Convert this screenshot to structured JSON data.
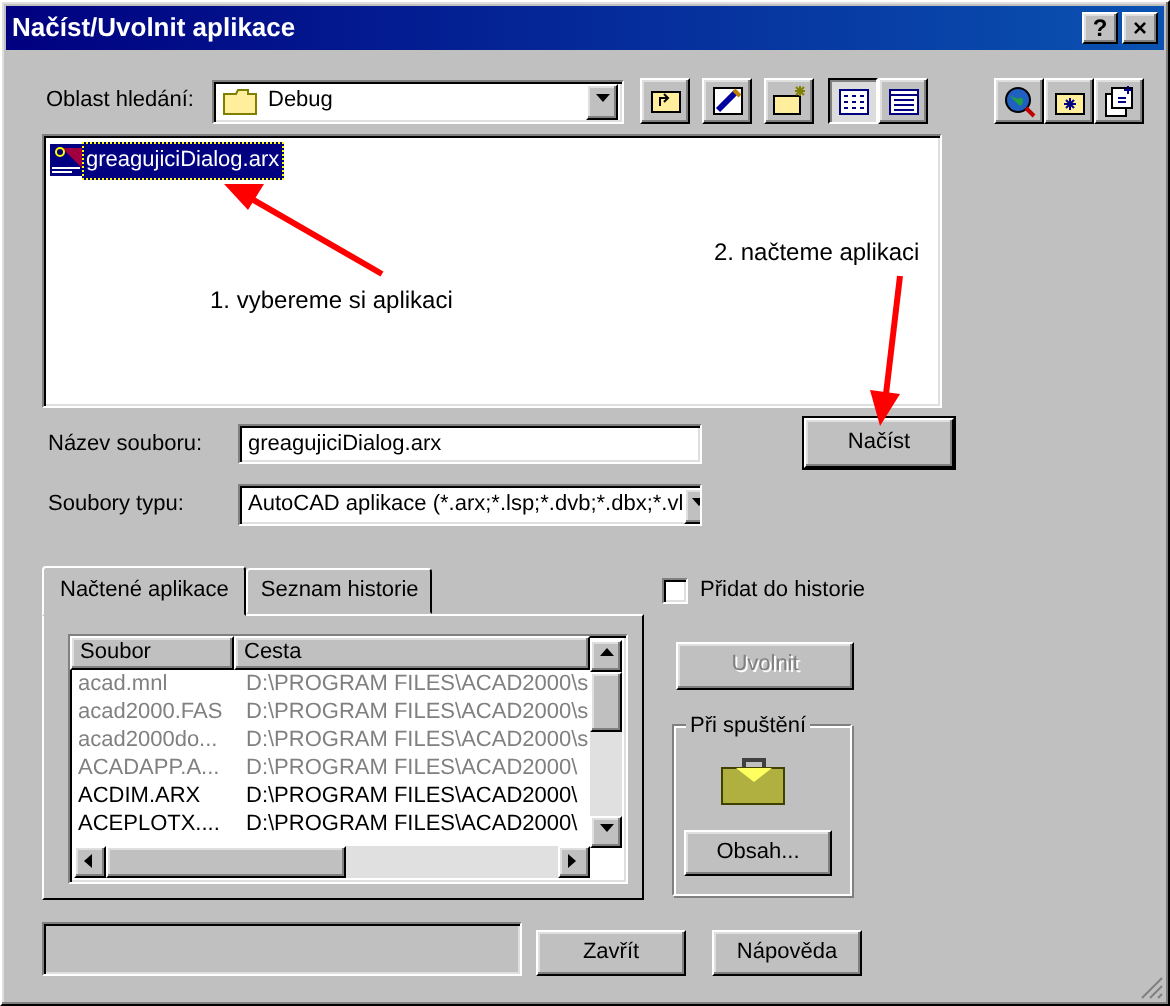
{
  "window": {
    "title": "Načíst/Uvolnit aplikace",
    "title_buttons": [
      "?",
      "×"
    ]
  },
  "look_in": {
    "label": "Oblast hledání:",
    "value": "Debug"
  },
  "files": [
    {
      "name": "greagujiciDialog.arx",
      "selected": true
    }
  ],
  "annotations": [
    {
      "text": "1. vybereme si aplikaci"
    },
    {
      "text": "2. načteme aplikaci"
    }
  ],
  "file_name": {
    "label": "Název souboru:",
    "value": "greagujiciDialog.arx"
  },
  "load_button": "Načíst",
  "file_type": {
    "label": "Soubory typu:",
    "value": "AutoCAD aplikace (*.arx;*.lsp;*.dvb;*.dbx;*.vl"
  },
  "tabs": [
    {
      "label": "Načtené aplikace",
      "selected": true
    },
    {
      "label": "Seznam historie",
      "selected": false
    }
  ],
  "loaded_apps": {
    "columns": [
      "Soubor",
      "Cesta"
    ],
    "rows": [
      {
        "file": "acad.mnl",
        "path": "D:\\PROGRAM FILES\\ACAD2000\\s",
        "disabled": true
      },
      {
        "file": "acad2000.FAS",
        "path": "D:\\PROGRAM FILES\\ACAD2000\\s",
        "disabled": true
      },
      {
        "file": "acad2000do...",
        "path": "D:\\PROGRAM FILES\\ACAD2000\\s",
        "disabled": true
      },
      {
        "file": "ACADAPP.A...",
        "path": "D:\\PROGRAM FILES\\ACAD2000\\",
        "disabled": true
      },
      {
        "file": "ACDIM.ARX",
        "path": "D:\\PROGRAM FILES\\ACAD2000\\",
        "disabled": false
      },
      {
        "file": "ACEPLOTX....",
        "path": "D:\\PROGRAM FILES\\ACAD2000\\",
        "disabled": false
      }
    ]
  },
  "add_to_history": {
    "label": "Přidat do historie",
    "checked": false
  },
  "unload_button": {
    "label": "Uvolnit",
    "disabled": true
  },
  "startup": {
    "title": "Při spuštění",
    "button": "Obsah..."
  },
  "buttons": [
    "Zavřít",
    "Nápověda"
  ]
}
